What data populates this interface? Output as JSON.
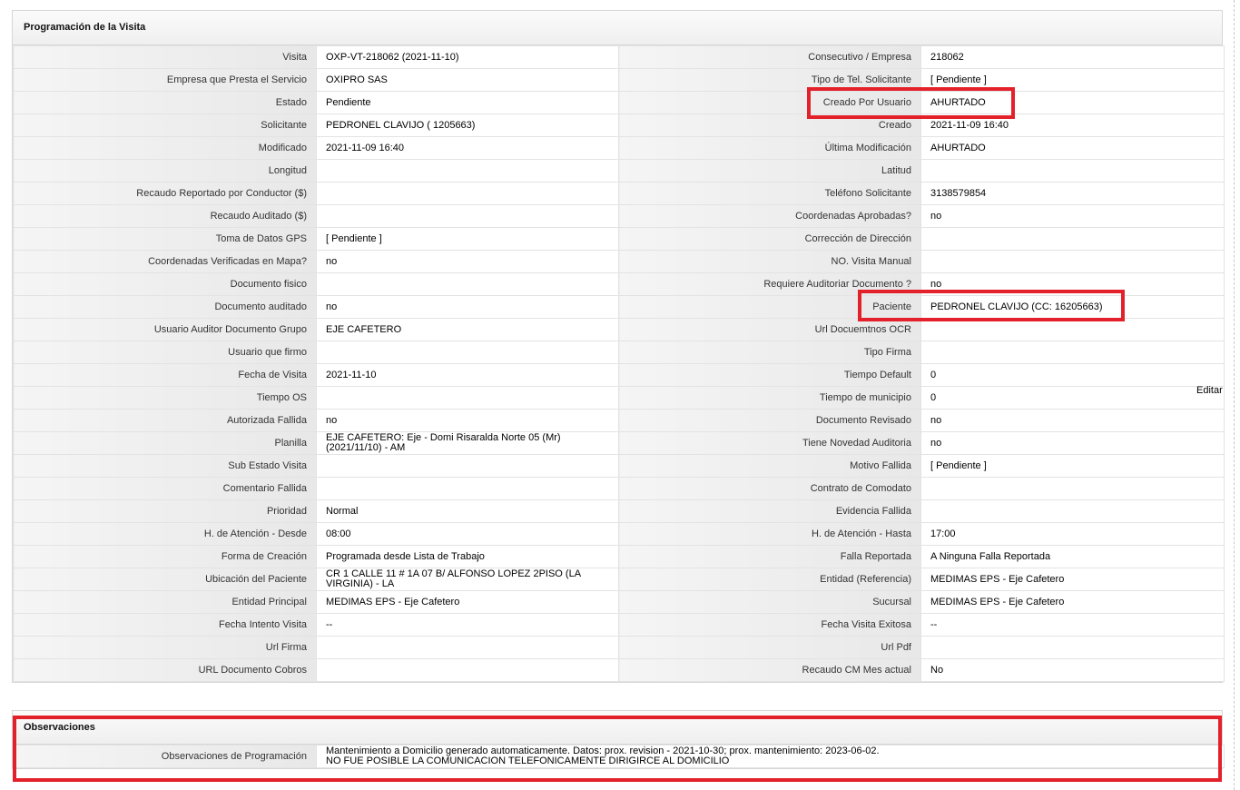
{
  "section_title": "Programación de la Visita",
  "rows": [
    {
      "l1": "Visita",
      "v1": "OXP-VT-218062 (2021-11-10)",
      "l2": "Consecutivo / Empresa",
      "v2": "218062"
    },
    {
      "l1": "Empresa que Presta el Servicio",
      "v1": "OXIPRO SAS",
      "l2": "Tipo de Tel. Solicitante",
      "v2": "[ Pendiente ]"
    },
    {
      "l1": "Estado",
      "v1": "Pendiente",
      "l2": "Creado Por Usuario",
      "v2": "AHURTADO"
    },
    {
      "l1": "Solicitante",
      "v1": "PEDRONEL CLAVIJO ( 1205663)",
      "l2": "Creado",
      "v2": "2021-11-09 16:40"
    },
    {
      "l1": "Modificado",
      "v1": "2021-11-09 16:40",
      "l2": "Última Modificación",
      "v2": " AHURTADO"
    },
    {
      "l1": "Longitud",
      "v1": "",
      "l2": "Latitud",
      "v2": ""
    },
    {
      "l1": "Recaudo Reportado por Conductor ($)",
      "v1": "",
      "l2": "Teléfono Solicitante",
      "v2": "3138579854"
    },
    {
      "l1": "Recaudo Auditado ($)",
      "v1": "",
      "l2": "Coordenadas Aprobadas?",
      "v2": " no"
    },
    {
      "l1": "Toma de Datos GPS",
      "v1": "[ Pendiente ]",
      "l2": "Corrección de Dirección",
      "v2": ""
    },
    {
      "l1": "Coordenadas Verificadas en Mapa?",
      "v1": " no",
      "l2": "NO. Visita Manual",
      "v2": ""
    },
    {
      "l1": "Documento fisico",
      "v1": "",
      "l2": "Requiere Auditoriar Documento ?",
      "v2": " no"
    },
    {
      "l1": "Documento auditado",
      "v1": " no",
      "l2": "Paciente",
      "v2": "PEDRONEL CLAVIJO (CC: 16205663)"
    },
    {
      "l1": "Usuario Auditor Documento Grupo",
      "v1": "EJE CAFETERO",
      "l2": "Url Docuemtnos OCR",
      "v2": ""
    },
    {
      "l1": "Usuario que firmo",
      "v1": "",
      "l2": "Tipo Firma",
      "v2": ""
    },
    {
      "l1": "Fecha de Visita",
      "v1": " 2021-11-10",
      "l2": "Tiempo Default",
      "v2": "0"
    },
    {
      "l1": "Tiempo OS",
      "v1": "",
      "l2": "Tiempo de municipio",
      "v2": "0"
    },
    {
      "l1": "Autorizada Fallida",
      "v1": " no",
      "l2": "Documento Revisado",
      "v2": " no"
    },
    {
      "l1": "Planilla",
      "v1": "EJE CAFETERO: Eje - Domi Risaralda Norte 05 (Mr) (2021/11/10) - AM",
      "l2": "Tiene Novedad Auditoria",
      "v2": " no"
    },
    {
      "l1": "Sub Estado Visita",
      "v1": "",
      "l2": "Motivo Fallida",
      "v2": "[ Pendiente ]"
    },
    {
      "l1": "Comentario Fallida",
      "v1": "",
      "l2": "Contrato de Comodato",
      "v2": ""
    },
    {
      "l1": "Prioridad",
      "v1": "Normal",
      "l2": "Evidencia Fallida",
      "v2": ""
    },
    {
      "l1": "H. de Atención - Desde",
      "v1": "08:00",
      "l2": "H. de Atención - Hasta",
      "v2": "17:00"
    },
    {
      "l1": "Forma de Creación",
      "v1": "Programada desde Lista de Trabajo",
      "l2": "Falla Reportada",
      "v2": "A Ninguna Falla Reportada"
    },
    {
      "l1": "Ubicación del Paciente",
      "v1": "CR 1 CALLE 11 # 1A 07 B/ ALFONSO LOPEZ 2PISO (LA VIRGINIA) - LA",
      "l2": "Entidad (Referencia)",
      "v2": "MEDIMAS EPS - Eje Cafetero"
    },
    {
      "l1": "Entidad Principal",
      "v1": "MEDIMAS EPS - Eje Cafetero",
      "l2": "Sucursal",
      "v2": "MEDIMAS EPS - Eje Cafetero"
    },
    {
      "l1": "Fecha Intento Visita",
      "v1": " --",
      "l2": "Fecha Visita Exitosa",
      "v2": " --"
    },
    {
      "l1": "Url Firma",
      "v1": "",
      "l2": "Url Pdf",
      "v2": ""
    },
    {
      "l1": "URL Documento Cobros",
      "v1": "",
      "l2": "Recaudo CM Mes actual",
      "v2": "No"
    }
  ],
  "edit_link": "Editar",
  "observations": {
    "title": "Observaciones",
    "label": "Observaciones de Programación",
    "line1": "Mantenimiento a Domicilio generado automaticamente. Datos: prox. revision - 2021-10-30; prox. mantenimiento: 2023-06-02.",
    "line2": "NO FUE POSIBLE LA COMUNICACION TELEFONICAMENTE DIRIGIRCE AL DOMICILIO"
  },
  "colors": {
    "highlight": "#e3212b",
    "header_bg": "#f2f2f2",
    "label_bg": "#ececec"
  }
}
